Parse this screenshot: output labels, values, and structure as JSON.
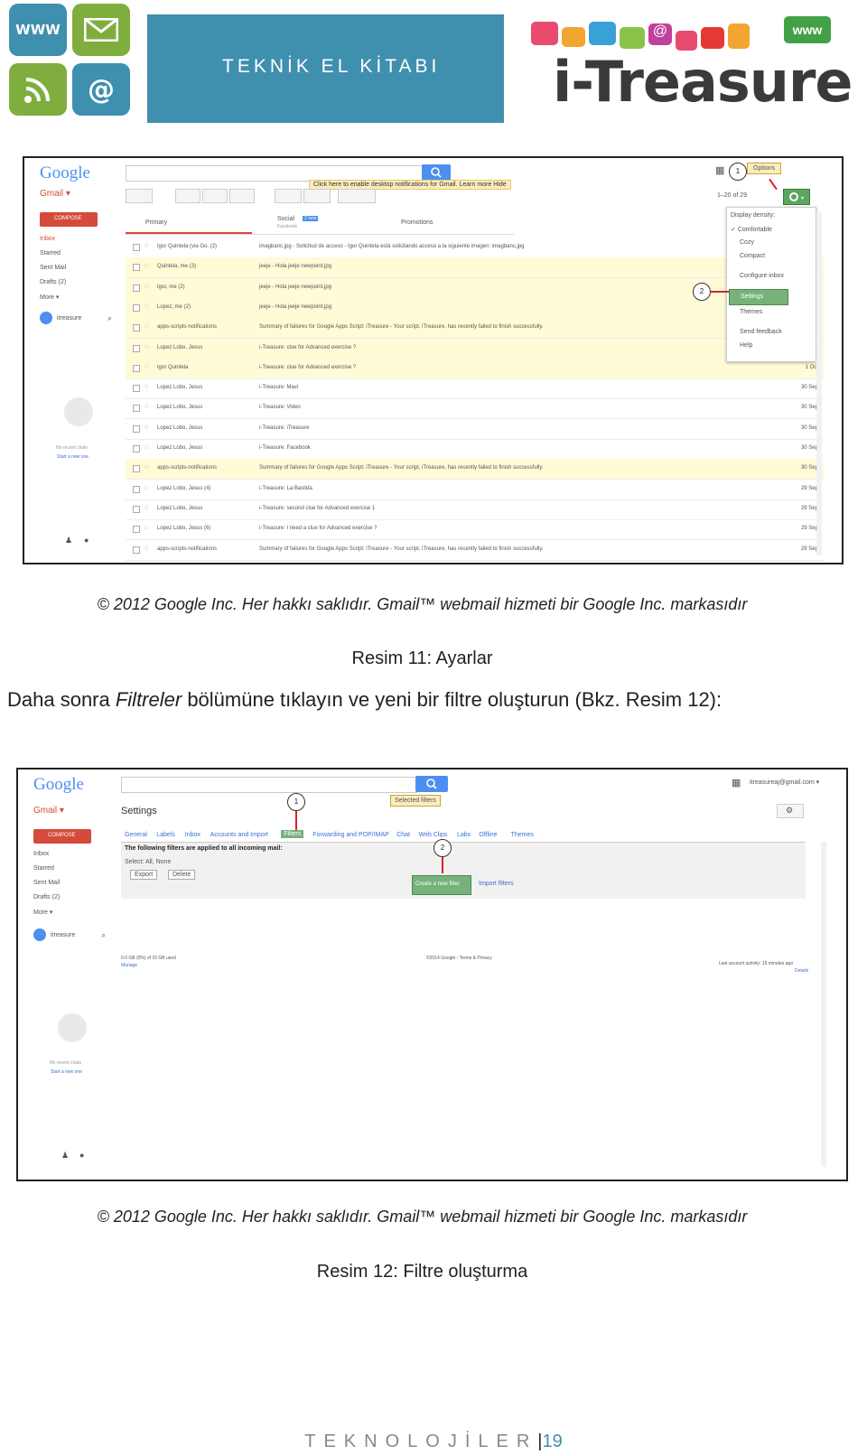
{
  "header": {
    "banner_title": "TEKNİK EL KİTABI",
    "logo_text": "i-Treasure",
    "logo_badge": "www",
    "icon_www": "WWW",
    "icon_mail": "envelope-icon",
    "icon_wifi": "wifi-icon",
    "icon_at": "@"
  },
  "figure1": {
    "logo": "Google",
    "gmail_label": "Gmail ▾",
    "compose": "COMPOSE",
    "notification": "Click here to enable desktop notifications for Gmail.  Learn more  Hide",
    "options_label": "Options",
    "bubble1": "1",
    "bubble2": "2",
    "pagination": "1–20 of 29",
    "tabs": [
      "Primary",
      "Social",
      "Promotions"
    ],
    "social_badge": "2 new",
    "social_sub": "Facebook",
    "nav": [
      "Inbox",
      "Starred",
      "Sent Mail",
      "Drafts (2)",
      "More ▾"
    ],
    "user": "itreasure",
    "chat_text1": "No recent chats",
    "chat_text2": "Start a new one",
    "menu": [
      "Display density:",
      "Comfortable",
      "Cozy",
      "Compact",
      "Configure inbox",
      "Settings",
      "Themes",
      "Send feedback",
      "Help"
    ],
    "rows": [
      {
        "s": "Igor Quintela (via Go. (2)",
        "m": "imagbanc.jpg - Solicitud de acceso - Igor Quintela está solicitando acceso a la siguiente imagen: imagbanc.jpg",
        "d": "",
        "y": false
      },
      {
        "s": "Quintela, me (3)",
        "m": "jeeje - Hola jeeje newpoint.jpg",
        "d": "",
        "y": true
      },
      {
        "s": "Igor, me (2)",
        "m": "jeeje - Hola jeeje newpoint.jpg",
        "d": "",
        "y": true
      },
      {
        "s": "Lopez, me (2)",
        "m": "jeeje - Hola jeeje newpoint.jpg",
        "d": "",
        "y": true
      },
      {
        "s": "apps-scripts-notifications",
        "m": "Summary of failures for Google Apps Script: iTreasure - Your script, iTreasure, has recently failed to finish successfully.",
        "d": "",
        "y": true
      },
      {
        "s": "Lopez Lobo, Jesus",
        "m": "i-Treasure: clue for Advanced exercise ?",
        "d": "",
        "y": true
      },
      {
        "s": "Igor Quintela",
        "m": "i-Treasure: clue for Advanced exercise ?",
        "d": "1 Oct",
        "y": true
      },
      {
        "s": "Lopez Lobo, Jesus",
        "m": "i-Treasure: Mavi",
        "d": "30 Sep",
        "y": false
      },
      {
        "s": "Lopez Lobo, Jesus",
        "m": "i-Treasure: Video",
        "d": "30 Sep",
        "y": false
      },
      {
        "s": "Lopez Lobo, Jesus",
        "m": "i-Treasure: iTreasure",
        "d": "30 Sep",
        "y": false
      },
      {
        "s": "Lopez Lobo, Jesus",
        "m": "i-Treasure: Facebook",
        "d": "30 Sep",
        "y": false
      },
      {
        "s": "apps-scripts-notifications",
        "m": "Summary of failures for Google Apps Script: iTreasure - Your script, iTreasure, has recently failed to finish successfully.",
        "d": "30 Sep",
        "y": true
      },
      {
        "s": "Lopez Lobo, Jesus (4)",
        "m": "i-Treasure: La Bastida",
        "d": "29 Sep",
        "y": false
      },
      {
        "s": "Lopez Lobo, Jesus",
        "m": "i-Treasure: second clue for Advanced exercise 1",
        "d": "29 Sep",
        "y": false
      },
      {
        "s": "Lopez Lobo, Jesus (6)",
        "m": "i-Treasure: I need a clue for Advanced exercise ?",
        "d": "29 Sep",
        "y": false
      },
      {
        "s": "apps-scripts-notifications",
        "m": "Summary of failures for Google Apps Script: iTreasure - Your script, iTreasure, has recently failed to finish successfully.",
        "d": "29 Sep",
        "y": false
      }
    ]
  },
  "caption1": "© 2012 Google Inc. Her hakkı saklıdır. Gmail™ webmail hizmeti bir Google Inc. markasıdır",
  "title1": "Resim 11: Ayarlar",
  "paragraph": {
    "before": "Daha sonra ",
    "emph": "Filtreler",
    "after": " bölümüne tıklayın ve yeni bir filtre oluşturun (Bkz. Resim 12):"
  },
  "figure2": {
    "logo": "Google",
    "gmail_label": "Gmail ▾",
    "compose": "COMPOSE",
    "settings_title": "Settings",
    "account": "itreasureaj@gmail.com ▾",
    "tooltip": "Selected filters",
    "bubble1": "1",
    "bubble2": "2",
    "tabs": [
      "General",
      "Labels",
      "Inbox",
      "Accounts and Import",
      "Filters",
      "Forwarding and POP/IMAP",
      "Chat",
      "Web Clips",
      "Labs",
      "Offline",
      "Themes"
    ],
    "filters_note": "The following filters are applied to all incoming mail:",
    "select_line": "Select: All, None",
    "export_btn": "Export",
    "delete_btn": "Delete",
    "create_btn": "Create a new filter",
    "import_link": "Import filters",
    "nav": [
      "Inbox",
      "Starred",
      "Sent Mail",
      "Drafts (2)",
      "More ▾"
    ],
    "user": "itreasure",
    "usage": "0.0 GB (0%) of 15 GB used",
    "manage": "Manage",
    "footer_center": "©2014 Google - Terms & Privacy",
    "footer_right": "Last account activity: 15 minutes ago",
    "details": "Details",
    "chat_text1": "No recent chats",
    "chat_text2": "Start a new one"
  },
  "caption2": "© 2012 Google Inc. Her hakkı saklıdır. Gmail™ webmail hizmeti bir Google Inc. markasıdır",
  "title2": "Resim 12: Filtre oluşturma",
  "footer": {
    "label": "TEKNOLOJİLER",
    "separator": "|",
    "page": "19"
  }
}
